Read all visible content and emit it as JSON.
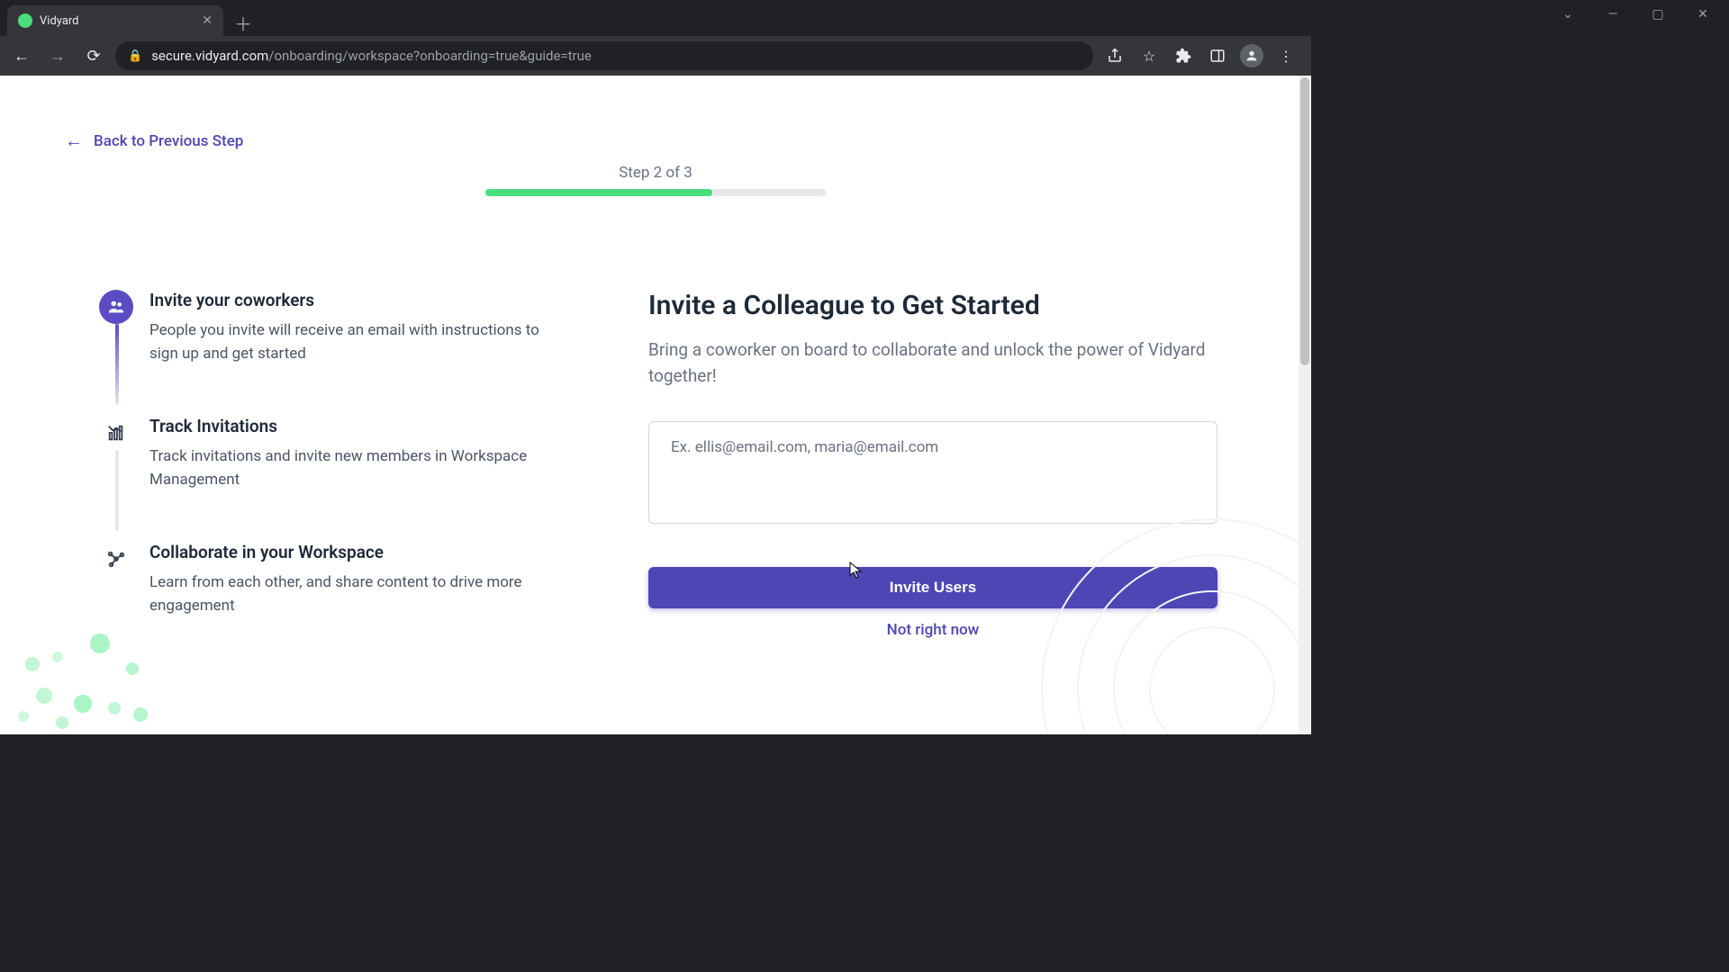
{
  "browser": {
    "tab_title": "Vidyard",
    "url_domain": "secure.vidyard.com",
    "url_path": "/onboarding/workspace?onboarding=true&guide=true"
  },
  "nav": {
    "back_label": "Back to Previous Step"
  },
  "progress": {
    "step_label": "Step 2 of 3",
    "percent": 66.6
  },
  "steps": [
    {
      "title": "Invite your coworkers",
      "desc": "People you invite will receive an email with instructions to sign up and get started"
    },
    {
      "title": "Track Invitations",
      "desc": "Track invitations and invite new members in Workspace Management"
    },
    {
      "title": "Collaborate in your Workspace",
      "desc": "Learn from each other, and share content to drive more engagement"
    }
  ],
  "form": {
    "heading": "Invite a Colleague to Get Started",
    "subheading": "Bring a coworker on board to collaborate and unlock the power of Vidyard together!",
    "email_placeholder": "Ex. ellis@email.com, maria@email.com",
    "invite_label": "Invite Users",
    "skip_label": "Not right now"
  }
}
